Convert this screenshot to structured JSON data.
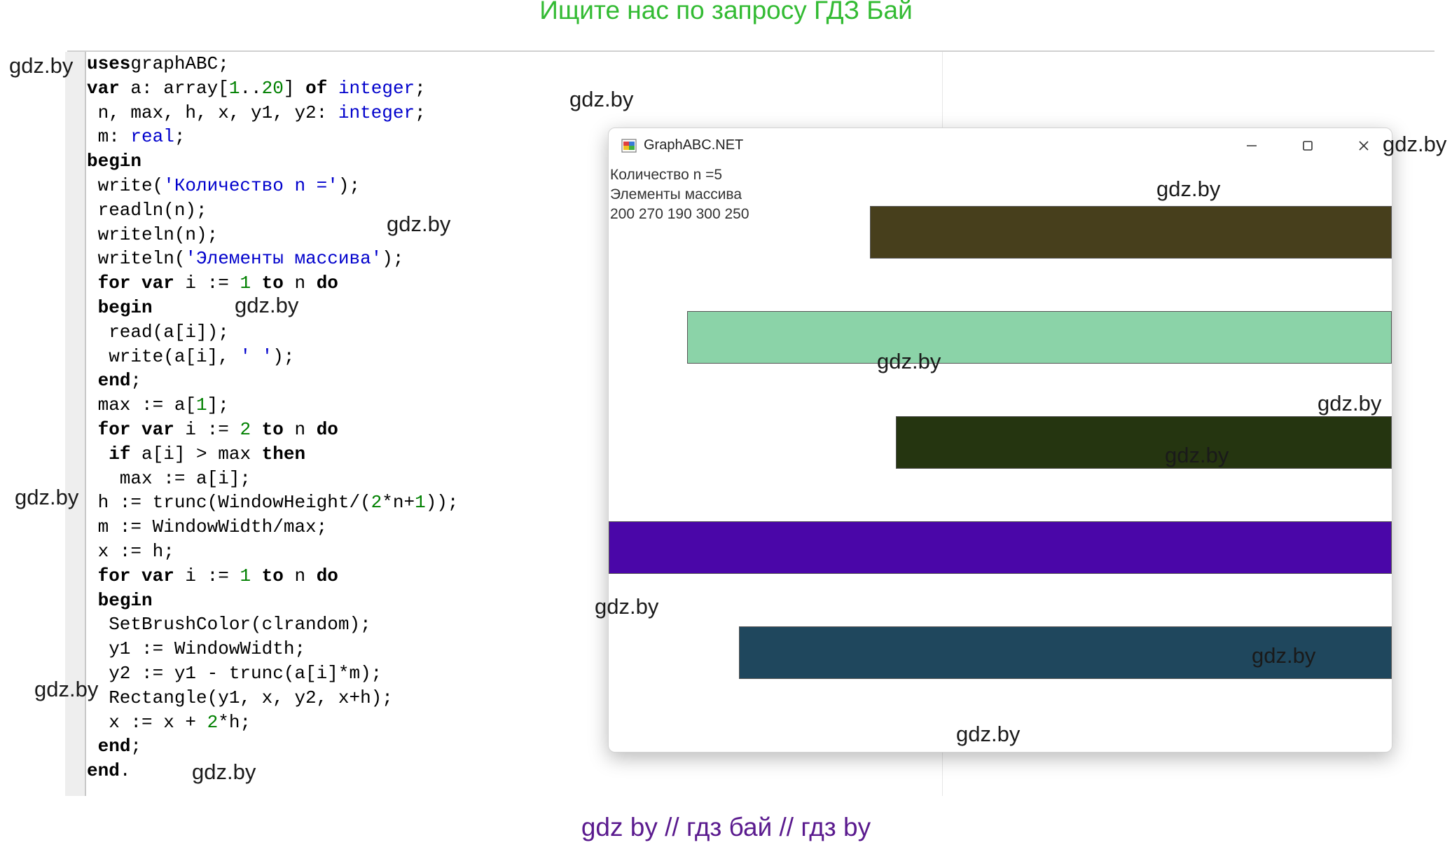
{
  "banner_top": "Ищите нас по запросу ГДЗ Бай",
  "banner_bottom": "gdz by  //  гдз бай  //  гдз by",
  "watermark": "gdz.by",
  "code_lines": [
    [
      [
        "kw",
        "uses"
      ],
      [
        "",
        "graphABC;"
      ]
    ],
    [
      [
        "kw",
        "var"
      ],
      [
        "",
        " a: array["
      ],
      [
        "num",
        "1"
      ],
      [
        "",
        ".."
      ],
      [
        "num",
        "20"
      ],
      [
        "",
        "] "
      ],
      [
        "kw",
        "of"
      ],
      [
        "",
        " "
      ],
      [
        "ty",
        "integer"
      ],
      [
        "",
        ";"
      ]
    ],
    [
      [
        "",
        " n, max, h, x, y1, y2: "
      ],
      [
        "ty",
        "integer"
      ],
      [
        "",
        ";"
      ]
    ],
    [
      [
        "",
        " m: "
      ],
      [
        "ty",
        "real"
      ],
      [
        "",
        ";"
      ]
    ],
    [
      [
        "kw",
        "begin"
      ]
    ],
    [
      [
        "",
        " write("
      ],
      [
        "str",
        "'Количество n ='"
      ],
      [
        "",
        ");"
      ]
    ],
    [
      [
        "",
        " readln(n);"
      ]
    ],
    [
      [
        "",
        " writeln(n);"
      ]
    ],
    [
      [
        "",
        " writeln("
      ],
      [
        "str",
        "'Элементы массива'"
      ],
      [
        "",
        ");"
      ]
    ],
    [
      [
        "",
        " "
      ],
      [
        "kw",
        "for var"
      ],
      [
        "",
        " i := "
      ],
      [
        "num",
        "1"
      ],
      [
        "",
        " "
      ],
      [
        "kw",
        "to"
      ],
      [
        "",
        " n "
      ],
      [
        "kw",
        "do"
      ]
    ],
    [
      [
        "",
        " "
      ],
      [
        "kw",
        "begin"
      ]
    ],
    [
      [
        "",
        "  read(a[i]);"
      ]
    ],
    [
      [
        "",
        "  write(a[i], "
      ],
      [
        "str",
        "' '"
      ],
      [
        "",
        ");"
      ]
    ],
    [
      [
        "",
        " "
      ],
      [
        "kw",
        "end"
      ],
      [
        "",
        ";"
      ]
    ],
    [
      [
        "",
        " max := a["
      ],
      [
        "num",
        "1"
      ],
      [
        "",
        "];"
      ]
    ],
    [
      [
        "",
        " "
      ],
      [
        "kw",
        "for var"
      ],
      [
        "",
        " i := "
      ],
      [
        "num",
        "2"
      ],
      [
        "",
        " "
      ],
      [
        "kw",
        "to"
      ],
      [
        "",
        " n "
      ],
      [
        "kw",
        "do"
      ]
    ],
    [
      [
        "",
        "  "
      ],
      [
        "kw",
        "if"
      ],
      [
        "",
        " a[i] > max "
      ],
      [
        "kw",
        "then"
      ]
    ],
    [
      [
        "",
        "   max := a[i];"
      ]
    ],
    [
      [
        "",
        " h := trunc(WindowHeight/("
      ],
      [
        "num",
        "2"
      ],
      [
        "",
        "*n+"
      ],
      [
        "num",
        "1"
      ],
      [
        "",
        "));"
      ]
    ],
    [
      [
        "",
        " m := WindowWidth/max;"
      ]
    ],
    [
      [
        "",
        " x := h;"
      ]
    ],
    [
      [
        "",
        " "
      ],
      [
        "kw",
        "for var"
      ],
      [
        "",
        " i := "
      ],
      [
        "num",
        "1"
      ],
      [
        "",
        " "
      ],
      [
        "kw",
        "to"
      ],
      [
        "",
        " n "
      ],
      [
        "kw",
        "do"
      ]
    ],
    [
      [
        "",
        " "
      ],
      [
        "kw",
        "begin"
      ]
    ],
    [
      [
        "",
        "  SetBrushColor(clrandom);"
      ]
    ],
    [
      [
        "",
        "  y1 := WindowWidth;"
      ]
    ],
    [
      [
        "",
        "  y2 := y1 - trunc(a[i]*m);"
      ]
    ],
    [
      [
        "",
        "  Rectangle(y1, x, y2, x+h);"
      ]
    ],
    [
      [
        "",
        "  x := x + "
      ],
      [
        "num",
        "2"
      ],
      [
        "",
        "*h;"
      ]
    ],
    [
      [
        "",
        " "
      ],
      [
        "kw",
        "end"
      ],
      [
        "",
        ";"
      ]
    ],
    [
      [
        "kw",
        "end"
      ],
      [
        "",
        "."
      ]
    ]
  ],
  "window": {
    "title": "GraphABC.NET",
    "minimize_glyph": "–",
    "maximize_glyph": "☐",
    "close_glyph": "✕",
    "output": [
      "Количество n =5",
      "Элементы массива",
      "200 270 190 300 250"
    ]
  },
  "chart_data": {
    "type": "bar",
    "orientation": "horizontal",
    "values": [
      200,
      270,
      190,
      300,
      250
    ],
    "colors": [
      "#473f1c",
      "#8bd3a8",
      "#253510",
      "#4a06a8",
      "#1f475d"
    ]
  }
}
